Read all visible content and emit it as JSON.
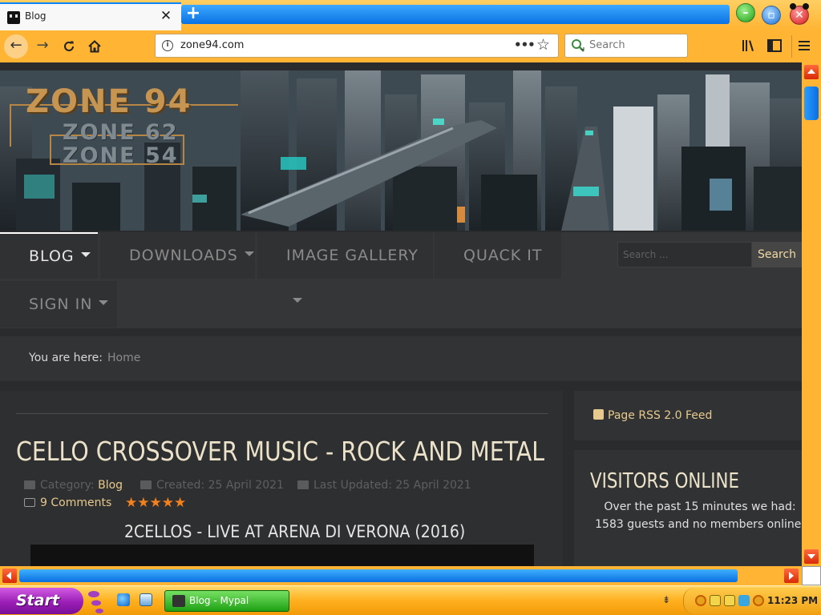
{
  "browser": {
    "tab": {
      "title": "Blog",
      "close": "✕"
    },
    "new_tab": "+",
    "url": "zone94.com",
    "search_placeholder": "Search",
    "more": "•••",
    "star": "☆"
  },
  "site": {
    "logo": {
      "main": "ZONE 94",
      "sub1": "ZONE 62",
      "sub2": "ZONE 54"
    },
    "nav": [
      {
        "label": "BLOG",
        "dropdown": true,
        "active": true
      },
      {
        "label": "DOWNLOADS",
        "dropdown": true
      },
      {
        "label": "IMAGE GALLERY",
        "dropdown": true
      },
      {
        "label": "QUACK IT",
        "dropdown": false
      },
      {
        "label": "SIGN IN",
        "dropdown": true
      }
    ],
    "search": {
      "placeholder": "Search ...",
      "button": "Search"
    },
    "breadcrumb": {
      "label": "You are here:",
      "home": "Home"
    },
    "article": {
      "title": "CELLO CROSSOVER MUSIC - ROCK AND METAL",
      "category_label": "Category:",
      "category": "Blog",
      "created": "Created: 25 April 2021",
      "updated": "Last Updated: 25 April 2021",
      "comments": "9 Comments",
      "rating_stars": 5,
      "stars": "★★★★★",
      "video_title": "2CELLOS - LIVE AT ARENA DI VERONA (2016)"
    },
    "rss": {
      "label": "Page RSS 2.0 Feed"
    },
    "visitors": {
      "title": "VISITORS ONLINE",
      "text": "Over the past 15 minutes we had: 1583 guests and no members online."
    }
  },
  "taskbar": {
    "start": "Start",
    "task_label": "Blog - Mypal",
    "clock": "11:23 PM"
  },
  "colors": {
    "accent_orange": "#ffb433",
    "nav_bg": "#353637",
    "link_gold": "#e8c98d",
    "star_orange": "#f2801d",
    "start_purple": "#9a1fb6",
    "task_green": "#1fa114"
  }
}
